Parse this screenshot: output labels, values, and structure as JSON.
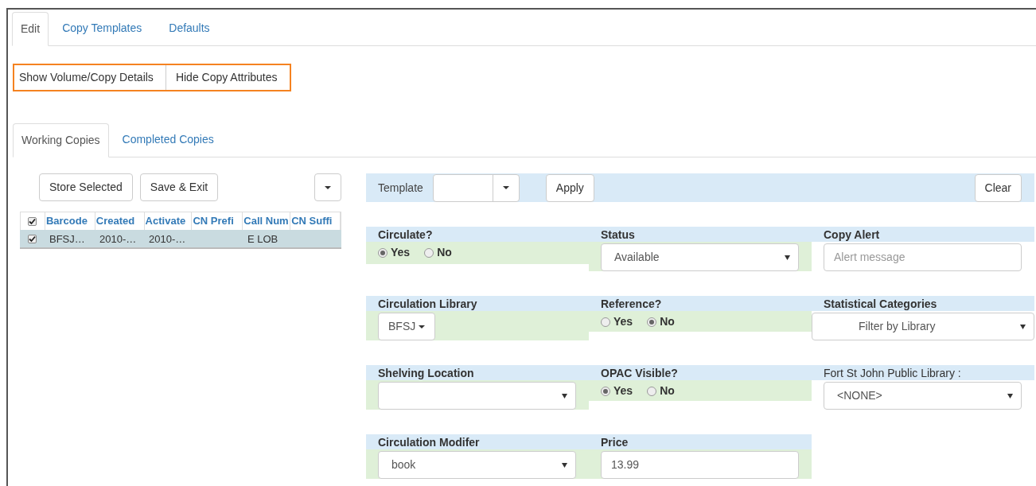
{
  "top_tabs": [
    {
      "label": "Edit",
      "selected": true
    },
    {
      "label": "Copy Templates",
      "selected": false
    },
    {
      "label": "Defaults",
      "selected": false
    }
  ],
  "toggle_buttons": [
    "Show Volume/Copy Details",
    "Hide Copy Attributes"
  ],
  "copy_tabs": [
    {
      "label": "Working Copies",
      "selected": true
    },
    {
      "label": "Completed Copies",
      "selected": false
    }
  ],
  "copy_actions": [
    "Store Selected",
    "Save & Exit"
  ],
  "copies_table": {
    "select_all_checked": true,
    "columns": [
      "Barcode",
      "Created",
      "Activate",
      "CN Prefi",
      "Call Num",
      "CN Suffi"
    ],
    "rows": [
      {
        "checked": true,
        "selected": true,
        "cells": [
          "BFSJ…",
          "2010-…",
          "2010-…",
          null,
          "E LOB",
          null
        ]
      }
    ]
  },
  "template_bar": {
    "label": "Template",
    "apply": "Apply",
    "clear": "Clear"
  },
  "field_rows": [
    [
      {
        "kind": "radio",
        "label": "Circulate?",
        "highlighted": true,
        "options": [
          {
            "label": "Yes",
            "selected": true
          },
          {
            "label": "No",
            "selected": false
          }
        ]
      },
      {
        "kind": "select",
        "label": "Status",
        "highlighted": true,
        "value": "Available"
      },
      {
        "kind": "input",
        "label": "Copy Alert",
        "highlighted": false,
        "placeholder": "Alert message"
      }
    ],
    [
      {
        "kind": "menu",
        "label": "Circulation Library",
        "highlighted": true,
        "value": "BFSJ"
      },
      {
        "kind": "radio",
        "label": "Reference?",
        "highlighted": true,
        "options": [
          {
            "label": "Yes",
            "selected": false
          },
          {
            "label": "No",
            "selected": true
          }
        ]
      },
      {
        "kind": "wide-select",
        "label": "Statistical Categories",
        "highlighted": false,
        "value": "Filter by Library"
      }
    ],
    [
      {
        "kind": "select",
        "label": "Shelving Location",
        "highlighted": true
      },
      {
        "kind": "radio",
        "label": "OPAC Visible?",
        "highlighted": true,
        "options": [
          {
            "label": "Yes",
            "selected": true
          },
          {
            "label": "No",
            "selected": false
          }
        ]
      },
      {
        "kind": "statcat",
        "label": "Fort St John Public Library :",
        "highlighted": false,
        "value": "<NONE>"
      }
    ],
    [
      {
        "kind": "select",
        "label": "Circulation Modifer",
        "highlighted": true,
        "value": "book"
      },
      {
        "kind": "input",
        "label": "Price",
        "highlighted": true,
        "value": "13.99"
      }
    ]
  ]
}
